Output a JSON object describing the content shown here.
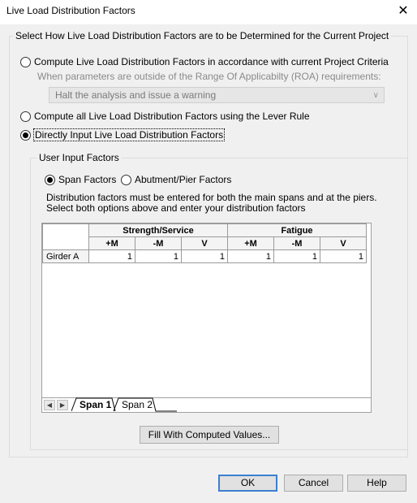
{
  "window": {
    "title": "Live Load Distribution Factors",
    "close_icon": "close-icon"
  },
  "method_group": {
    "label": "Select How Live Load Distribution Factors are to be Determined for the Current Project",
    "option_project_criteria": "Compute Live Load Distribution Factors in accordance with current Project Criteria",
    "roa_hint": "When parameters are outside of the Range Of Applicabilty (ROA) requirements:",
    "roa_dropdown_value": "Halt the analysis and issue a warning",
    "option_lever_rule": "Compute all Live Load Distribution Factors using the Lever Rule",
    "option_direct_input": "Directly Input Live Load Distribution Factors",
    "selected": "direct_input"
  },
  "user_input_group": {
    "label": "User Input Factors",
    "option_span": "Span Factors",
    "option_abutment": "Abutment/Pier Factors",
    "selected": "span",
    "info_line1": "Distribution factors must be entered for both the main spans and at the piers.",
    "info_line2": "Select both options above and enter your distribution factors"
  },
  "grid": {
    "group_strength": "Strength/Service",
    "group_fatigue": "Fatigue",
    "columns": [
      "+M",
      "-M",
      "V",
      "+M",
      "-M",
      "V"
    ],
    "rows": [
      {
        "label": "Girder A",
        "values": [
          "1",
          "1",
          "1",
          "1",
          "1",
          "1"
        ]
      }
    ],
    "tabs": [
      "Span 1",
      "Span 2"
    ],
    "active_tab": "Span 1"
  },
  "fill_button": "Fill With Computed Values...",
  "footer": {
    "ok": "OK",
    "cancel": "Cancel",
    "help": "Help"
  }
}
